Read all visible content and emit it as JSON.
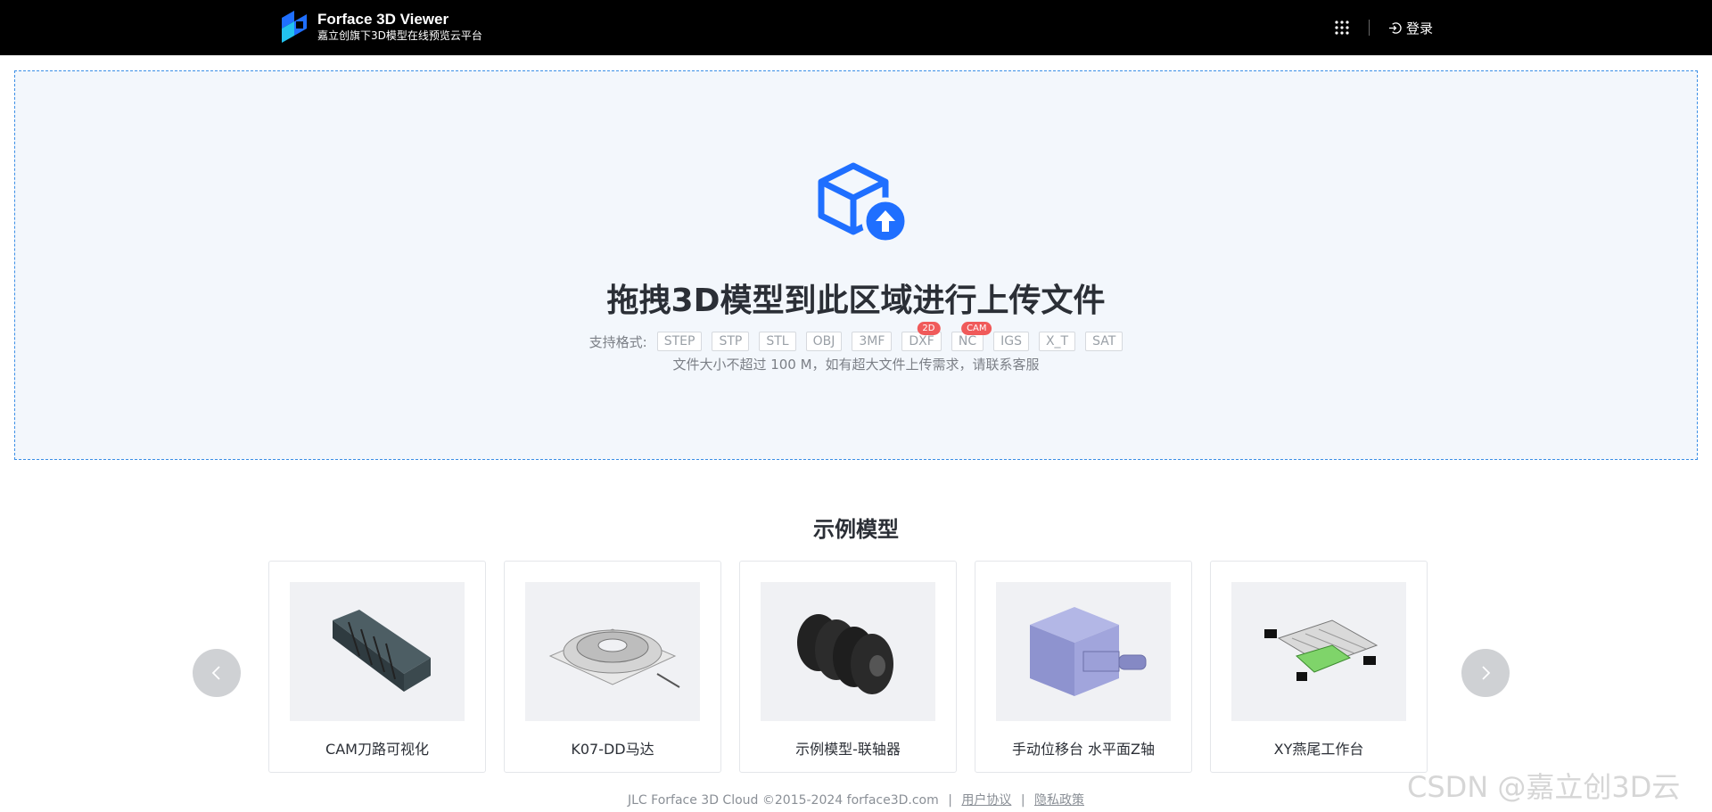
{
  "header": {
    "title": "Forface 3D Viewer",
    "subtitle": "嘉立创旗下3D模型在线预览云平台",
    "apps_icon": "grid-icon",
    "login_label": "登录"
  },
  "upload": {
    "title": "拖拽3D模型到此区域进行上传文件",
    "formats_label": "支持格式:",
    "formats": [
      {
        "name": "STEP",
        "badge": ""
      },
      {
        "name": "STP",
        "badge": ""
      },
      {
        "name": "STL",
        "badge": ""
      },
      {
        "name": "OBJ",
        "badge": ""
      },
      {
        "name": "3MF",
        "badge": ""
      },
      {
        "name": "DXF",
        "badge": "2D"
      },
      {
        "name": "NC",
        "badge": "CAM"
      },
      {
        "name": "IGS",
        "badge": ""
      },
      {
        "name": "X_T",
        "badge": ""
      },
      {
        "name": "SAT",
        "badge": ""
      }
    ],
    "size_note": "文件大小不超过 100 M，如有超大文件上传需求，请联系客服"
  },
  "examples": {
    "title": "示例模型",
    "prev_icon": "chevron-left-icon",
    "next_icon": "chevron-right-icon",
    "items": [
      {
        "label": "CAM刀路可视化"
      },
      {
        "label": "K07-DD马达"
      },
      {
        "label": "示例模型-联轴器"
      },
      {
        "label": "手动位移台 水平面Z轴"
      },
      {
        "label": "XY燕尾工作台"
      }
    ]
  },
  "footer": {
    "copyright": "JLC Forface 3D Cloud ©2015-2024 forface3D.com",
    "sep": "|",
    "terms": "用户协议",
    "privacy": "隐私政策"
  },
  "watermark": "CSDN @嘉立创3D云",
  "colors": {
    "accent": "#1f6fff",
    "badge": "#f05a5a",
    "topbar": "#000000"
  }
}
